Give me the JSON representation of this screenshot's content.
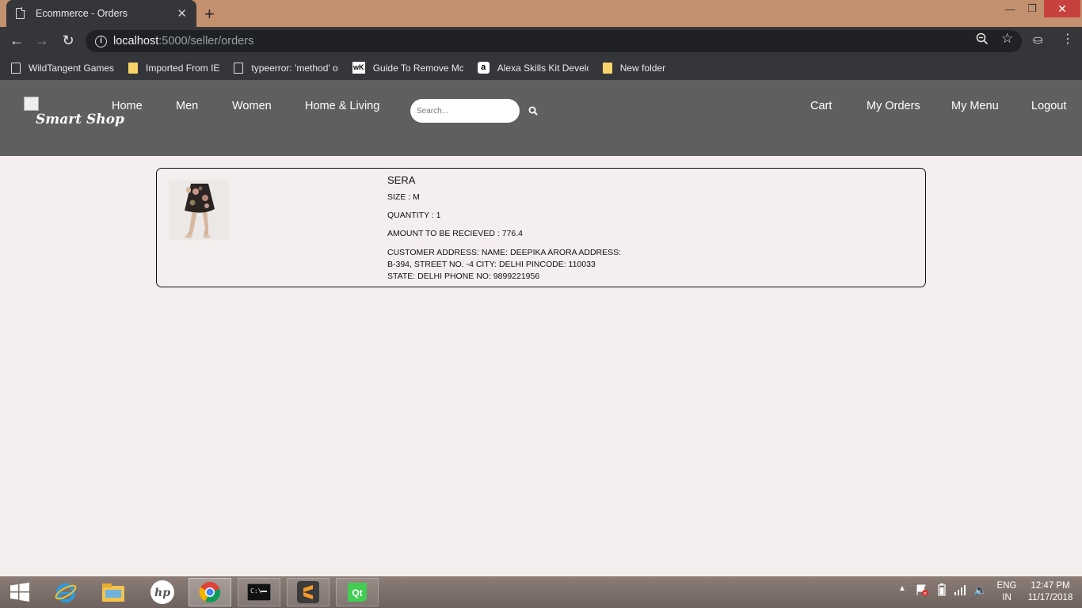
{
  "browser": {
    "tab_title": "Ecommerce - Orders",
    "url_host": "localhost",
    "url_path": ":5000/seller/orders",
    "bookmarks": [
      {
        "label": "WildTangent Games",
        "icon": "page-icon"
      },
      {
        "label": "Imported From IE",
        "icon": "folder-icon"
      },
      {
        "label": "typeerror: 'method' o",
        "icon": "page-icon"
      },
      {
        "label": "Guide To Remove Mc",
        "icon": "wikihow-icon"
      },
      {
        "label": "Alexa Skills Kit Develo",
        "icon": "amazon-icon"
      },
      {
        "label": "New folder",
        "icon": "folder-icon"
      }
    ]
  },
  "site": {
    "logo_text": "Smart Shop",
    "nav_left": {
      "home": "Home",
      "men": "Men",
      "women": "Women",
      "home_living": "Home & Living"
    },
    "search_placeholder": "Search...",
    "nav_right": {
      "cart": "Cart",
      "my_orders": "My Orders",
      "my_menu": "My Menu",
      "logout": "Logout"
    }
  },
  "order": {
    "product_name": "SERA",
    "size": "SIZE : M",
    "quantity": "QUANTITY : 1",
    "amount": "AMOUNT TO BE RECIEVED : 776.4",
    "address": "CUSTOMER ADDRESS: NAME: DEEPIKA ARORA ADDRESS: B-394, STREET NO. -4 CITY: DELHI PINCODE: 110033 STATE: DELHI PHONE NO: 9899221956"
  },
  "taskbar": {
    "lang_line1": "ENG",
    "lang_line2": "IN",
    "time": "12:47 PM",
    "date": "11/17/2018"
  },
  "colors": {
    "titlebar": "#c4916f",
    "chrome_dark": "#35363a",
    "site_header": "#5f5f5f",
    "page_bg": "#f4eeee",
    "close_red": "#c7413d"
  }
}
